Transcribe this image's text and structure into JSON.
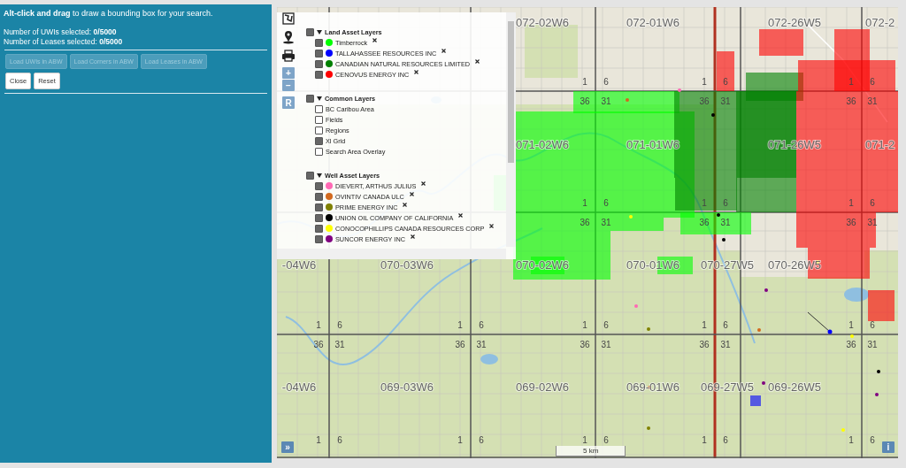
{
  "search_panel": {
    "instruction": "**Alt-click and drag** to draw a bounding box for your search.",
    "counts": [
      "Number of UWIs selected: **0/5000**",
      "Number of Leases selected: **0/5000**"
    ],
    "load_buttons": [
      {
        "label": "Load UWIs in ABW",
        "disabled": true
      },
      {
        "label": "Load Corners in ABW",
        "disabled": true
      },
      {
        "label": "Load Leases in ABW",
        "disabled": true
      }
    ],
    "action_buttons": [
      {
        "label": "Close",
        "disabled": false
      },
      {
        "label": "Reset",
        "disabled": false
      }
    ]
  },
  "map": {
    "township_rows": [
      {
        "r02w6": "072-02W6",
        "r01w6": "072-01W6",
        "r26w5": "072-26W5",
        "r25w5": "072-2"
      },
      {
        "r02w6": "071-02W6",
        "r01w6": "071-01W6",
        "r26w5": "071-26W5",
        "r25w5": "071-2"
      },
      {
        "r04w6": "-04W6",
        "r03w6": "070-03W6",
        "r02w6": "070-02W6",
        "r01w6": "070-01W6",
        "r27w5": "070-27W5",
        "r26w5": "070-26W5"
      },
      {
        "r04w6": "-04W6",
        "r03w6": "069-03W6",
        "r02w6": "069-02W6",
        "r01w6": "069-01W6",
        "r27w5": "069-27W5",
        "r26w5": "069-26W5"
      }
    ],
    "section_corners": [
      {
        "r01w6": {
          "above": [
            "1",
            "6"
          ],
          "below": [
            "36",
            "31"
          ]
        },
        "r27w5": {
          "above": [
            "1",
            "6"
          ],
          "below": [
            "36",
            "31"
          ]
        },
        "r25w5": {
          "above": [
            "1",
            "6"
          ],
          "below": [
            "36",
            "31"
          ]
        }
      },
      {
        "r01w6": {
          "above": [
            "1",
            "6"
          ],
          "below": [
            "36",
            "31"
          ]
        },
        "r27w5": {
          "above": [
            "1",
            "6"
          ],
          "below": [
            "36",
            "31"
          ]
        },
        "r25w5": {
          "above": [
            "1",
            "6"
          ],
          "below": [
            "36",
            "31"
          ]
        }
      },
      {
        "r03w6": {
          "above": [
            "1",
            "6"
          ],
          "below": [
            "36",
            "31"
          ]
        },
        "r02w6": {
          "above": [
            "1",
            "6"
          ],
          "below": [
            "36",
            "31"
          ]
        },
        "r01w6": {
          "above": [
            "1",
            "6"
          ],
          "below": [
            "36",
            "31"
          ]
        },
        "r27w5": {
          "above": [
            "1",
            "6"
          ],
          "below": [
            "36",
            "31"
          ]
        },
        "r25w5": {
          "above": [
            "1",
            "6"
          ],
          "below": [
            "36",
            "31"
          ]
        }
      },
      {
        "r03w6": {
          "above": [
            "1",
            "6"
          ]
        },
        "r02w6": {
          "above": [
            "1",
            "6"
          ]
        },
        "r01w6": {
          "above": [
            "1",
            "6"
          ]
        },
        "r27w5": {
          "above": [
            "1",
            "6"
          ]
        },
        "r25w5": {
          "above": [
            "1",
            "6"
          ]
        }
      }
    ],
    "scale": "5 km",
    "legend": [
      {
        "title": "Land Asset Layers",
        "checked": true,
        "expanded": true,
        "items": [
          {
            "label": "Timberrock",
            "checked": true,
            "color": "#00ff00",
            "removable": true
          },
          {
            "label": "TALLAHASSEE RESOURCES INC",
            "checked": true,
            "color": "#0000ff",
            "removable": true
          },
          {
            "label": "CANADIAN NATURAL RESOURCES LIMITED",
            "checked": true,
            "color": "#008000",
            "removable": true
          },
          {
            "label": "CENOVUS ENERGY INC",
            "checked": true,
            "color": "#ff0000",
            "removable": true
          }
        ]
      },
      {
        "title": "Common Layers",
        "checked": true,
        "expanded": true,
        "items": [
          {
            "label": "BC Caribou Area",
            "checked": false,
            "removable": false
          },
          {
            "label": "Fields",
            "checked": false,
            "removable": false
          },
          {
            "label": "Regions",
            "checked": false,
            "removable": false
          },
          {
            "label": "Xl Grid",
            "checked": true,
            "removable": false
          },
          {
            "label": "Search Area Overlay",
            "checked": false,
            "removable": false
          }
        ]
      },
      {
        "title": "Well Asset Layers",
        "checked": true,
        "expanded": true,
        "items": [
          {
            "label": "DIEVERT, ARTHUS JULIUS",
            "checked": true,
            "color": "#ff69b4",
            "removable": true
          },
          {
            "label": "OVINTIV CANADA ULC",
            "checked": true,
            "color": "#d2691e",
            "removable": true
          },
          {
            "label": "PRIME ENERGY INC",
            "checked": true,
            "color": "#808000",
            "removable": true
          },
          {
            "label": "UNION OIL COMPANY OF CALIFORNIA",
            "checked": true,
            "color": "#000000",
            "removable": true
          },
          {
            "label": "CONOCOPHILLIPS CANADA RESOURCES CORP",
            "checked": true,
            "color": "#ffff00",
            "removable": true
          },
          {
            "label": "SUNCOR ENERGY INC",
            "checked": true,
            "color": "#800080",
            "removable": true
          }
        ]
      }
    ],
    "zoom_controls": [
      "+",
      "−"
    ],
    "reset_control": "R",
    "expand_control": "»",
    "info_control": "i"
  }
}
